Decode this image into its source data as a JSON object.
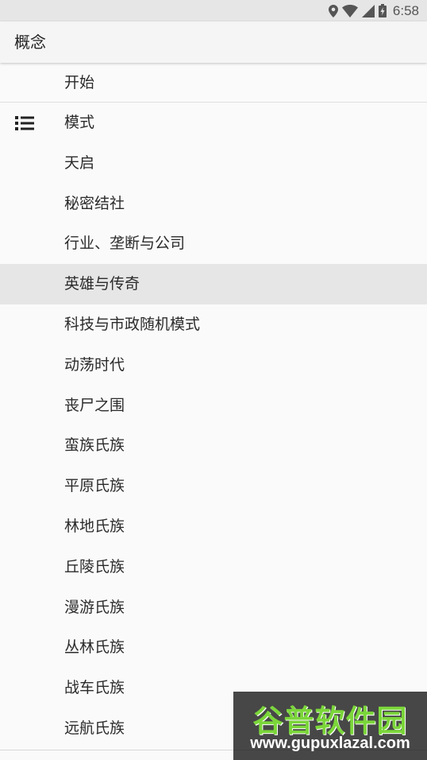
{
  "status_bar": {
    "time": "6:58",
    "icons": [
      "location-icon",
      "wifi-icon",
      "signal-icon",
      "battery-charging-icon"
    ]
  },
  "app_bar": {
    "title": "概念"
  },
  "menu": {
    "first_item": "开始",
    "items": [
      {
        "label": "模式",
        "icon": "list-icon"
      },
      {
        "label": "天启"
      },
      {
        "label": "秘密结社"
      },
      {
        "label": "行业、垄断与公司"
      },
      {
        "label": "英雄与传奇",
        "selected": true
      },
      {
        "label": "科技与市政随机模式"
      },
      {
        "label": "动荡时代"
      },
      {
        "label": "丧尸之围"
      },
      {
        "label": "蛮族氏族"
      },
      {
        "label": "平原氏族"
      },
      {
        "label": "林地氏族"
      },
      {
        "label": "丘陵氏族"
      },
      {
        "label": "漫游氏族"
      },
      {
        "label": "丛林氏族"
      },
      {
        "label": "战车氏族"
      },
      {
        "label": "远航氏族"
      }
    ]
  },
  "watermark": {
    "name": "谷普软件园",
    "url": "www.gupuxlazal.com"
  },
  "colors": {
    "background": "#fafafa",
    "status_bar": "#e6e6e6",
    "selected_row": "#e6e6e6",
    "watermark_green": "#7bd63a"
  }
}
